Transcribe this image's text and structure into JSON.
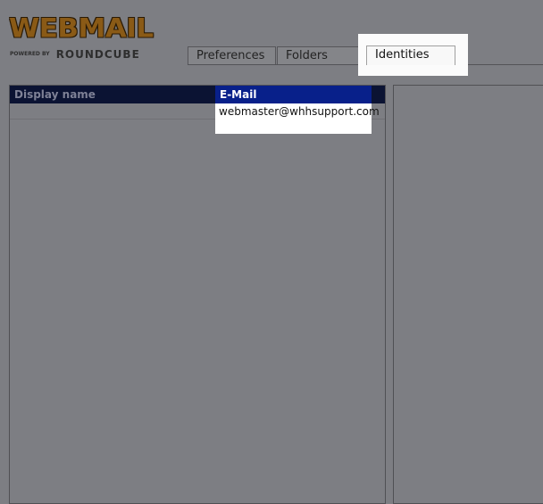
{
  "logo": {
    "title": "WEBMAIL",
    "powered_by": "POWERED BY",
    "brand": "ROUNDCUBE"
  },
  "tabs": [
    {
      "label": "Preferences",
      "active": false
    },
    {
      "label": "Folders",
      "active": false
    },
    {
      "label": "Identities",
      "active": true
    }
  ],
  "identities_table": {
    "columns": [
      "Display name",
      "E-Mail"
    ],
    "rows": [
      {
        "display_name": "",
        "email": "webmaster@whhsupport.com"
      }
    ]
  }
}
